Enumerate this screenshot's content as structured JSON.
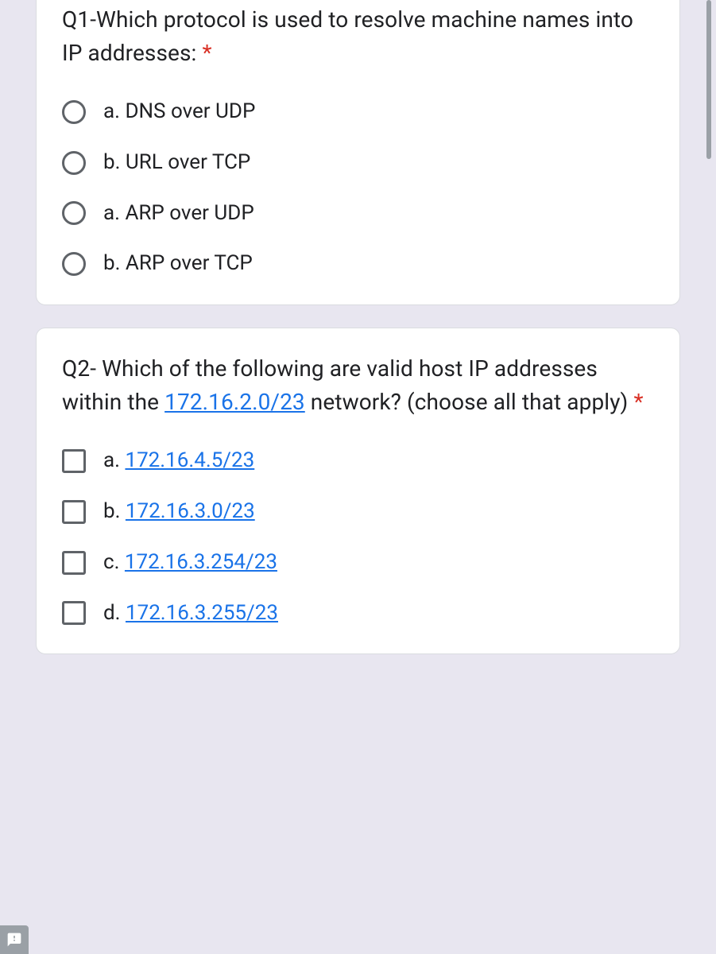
{
  "q1": {
    "title": "Q1-Which protocol is used to resolve machine names into IP addresses: ",
    "required": "*",
    "options": [
      "a. DNS over UDP",
      "b. URL over TCP",
      "a. ARP over UDP",
      "b. ARP over TCP"
    ]
  },
  "q2": {
    "title_pre": "Q2- Which of the following are valid host IP addresses within the ",
    "title_link": "172.16.2.0/23",
    "title_post": " network? (choose all that apply) ",
    "required": "*",
    "options": [
      {
        "prefix": "a. ",
        "link": "172.16.4.5/23"
      },
      {
        "prefix": "b. ",
        "link": "172.16.3.0/23"
      },
      {
        "prefix": "c. ",
        "link": "172.16.3.254/23"
      },
      {
        "prefix": "d. ",
        "link": "172.16.3.255/23"
      }
    ]
  }
}
